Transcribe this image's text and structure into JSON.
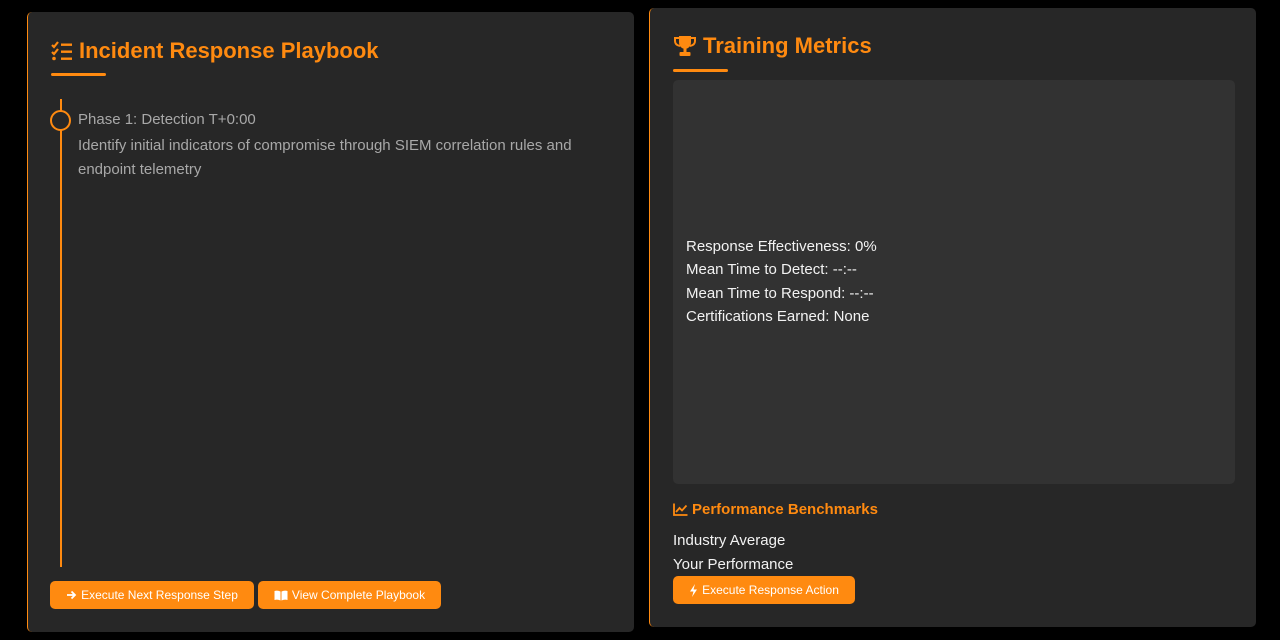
{
  "playbook": {
    "title": "Incident Response Playbook",
    "icon": "list-check-icon",
    "phases": [
      {
        "title": "Phase 1: Detection T+0:00",
        "description": "Identify initial indicators of compromise through SIEM correlation rules and endpoint telemetry"
      }
    ],
    "next_button": "Execute Next Response Step",
    "view_button": "View Complete Playbook"
  },
  "metrics": {
    "title": "Training Metrics",
    "icon": "trophy-icon",
    "lines": [
      "Response Effectiveness: 0%",
      "Mean Time to Detect: --:--",
      "Mean Time to Respond: --:--",
      "Certifications Earned: None"
    ],
    "benchmarks_title": "Performance Benchmarks",
    "benchmarks": [
      "Industry Average",
      "Your Performance"
    ],
    "execute_button": "Execute Response Action"
  },
  "colors": {
    "accent": "#ff8a10",
    "panel": "#272727",
    "background": "#000000"
  }
}
